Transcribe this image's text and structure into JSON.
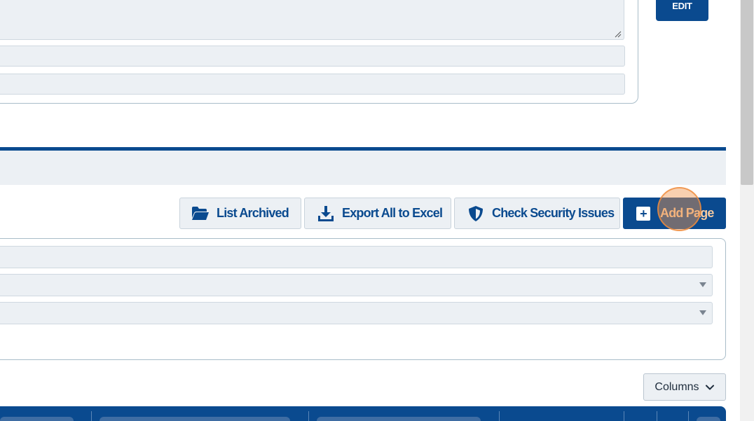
{
  "form_card": {
    "edit_label": "EDIT"
  },
  "toolbar": {
    "list_archived_label": "List Archived",
    "export_label": "Export All to Excel",
    "security_label": "Check Security Issues",
    "add_page_label": "Add Page"
  },
  "icons": {
    "list_archived": "folder-open-icon",
    "export": "download-icon",
    "security": "shield-icon",
    "add_page": "plus-square-icon",
    "columns": "chevron-down-icon"
  },
  "table": {
    "columns_label": "Columns"
  },
  "colors": {
    "primary": "#0a4a8f",
    "field_bg": "#ecf0f4",
    "highlight": "#f4c9a0"
  }
}
